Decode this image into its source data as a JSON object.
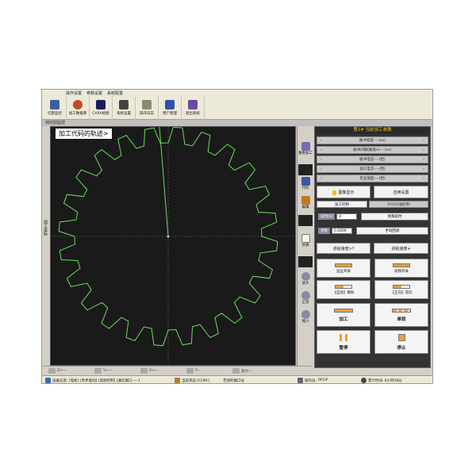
{
  "menubar": {
    "items": [
      "操作设置",
      "参数设置",
      "系统配置"
    ]
  },
  "toolbar": {
    "buttons": [
      {
        "label": "切割监控",
        "icon": "monitor-icon"
      },
      {
        "label": "加工数据库",
        "icon": "database-icon"
      },
      {
        "label": "CAXA绘图",
        "icon": "caxa-icon"
      },
      {
        "label": "系统设置",
        "icon": "settings-icon"
      },
      {
        "label": "操作日志",
        "icon": "log-icon"
      },
      {
        "label": "用户管理",
        "icon": "user-icon"
      },
      {
        "label": "退出系统",
        "icon": "exit-icon"
      }
    ]
  },
  "titlestrip": "线切割监控",
  "leftbar": {
    "label": "加工坐标"
  },
  "canvas": {
    "title": "加工代码的轨迹>"
  },
  "toolcol": {
    "tools": [
      {
        "label": "重看加工",
        "icon": "replay-icon"
      },
      {
        "label": "代码",
        "icon": "code-icon"
      },
      {
        "label": "编辑",
        "icon": "edit-icon"
      },
      {
        "label": "仿真",
        "icon": "simulate-icon"
      },
      {
        "label": "放大",
        "icon": "zoom-in-icon"
      },
      {
        "label": "正常",
        "icon": "normal-view-icon"
      },
      {
        "label": "缩小",
        "icon": "zoom-out-icon"
      }
    ]
  },
  "rpanel": {
    "title": "第1# 当前加工参数",
    "params": [
      "脉冲宽度----(us)",
      "脉冲间隔(脉宽x)----(us)",
      "脉冲电压----(档)",
      "加工电流----(档)",
      "走丝速度----(档)"
    ],
    "display_button": "图像显示",
    "apply_button": "应用设置",
    "tab_active": "加工控制",
    "tab_inactive": "XY/U/V轴控制",
    "delay_label": "延时(S)",
    "delay_value": "0",
    "corner_delay_button": "拐角延时",
    "step_label": "步距",
    "step_value": "0.5000",
    "manual_return_button": "手动回退",
    "feed_speed_button": "进给速度>?",
    "feed_speed_up_button": "进给速度+",
    "control_buttons": [
      "运丝开关",
      "高频开关",
      "【自动】模拟",
      "【正向】逆向",
      "加工",
      "单段",
      "暂停",
      "停止"
    ]
  },
  "bottombar": {
    "items": [
      "Z+---",
      "Y+---",
      "X+---",
      "Y---",
      "放大---"
    ]
  },
  "statusbar": {
    "device_status": "设备信息: [电机] [单步驱动] [高频控制] [通信端口:----]",
    "current_state": "当前状态:[COM:]",
    "port_status": "无效的端口号",
    "work_time_label": "操作员:",
    "work_time_value": "001#",
    "total_time_label": "累计时间:",
    "total_time_value": "0小时58分"
  },
  "colors": {
    "canvas_bg": "#1a1a1a",
    "path": "#66e05a",
    "accent": "#f0c020",
    "panel_bg": "#333333"
  }
}
